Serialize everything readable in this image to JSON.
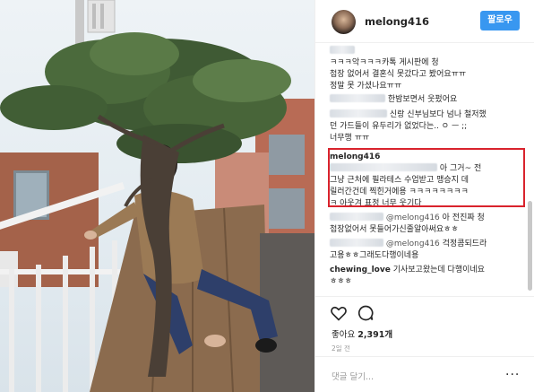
{
  "header": {
    "username": "melong416",
    "follow_label": "팔로우"
  },
  "comments": [
    {
      "text_lines": [
        "ㅋㅋㅋ악ㅋㅋㅋ카톡 게시판에 청",
        "첩장 없어서 결혼식 못갔다고 봤어요ㅠㅠ",
        "정말 못 가셨나요ㅠㅠ"
      ]
    },
    {
      "text": "한밤보면서 웃펐어요"
    },
    {
      "text_lines": [
        "신랑 신부님보다 넘나 철저했",
        "던 가드들이 유두리가 없었다는.. ㅇ ㅡ ;;",
        "너무행 ㅠㅠ"
      ]
    },
    {
      "user": "melong416",
      "text_lines": [
        "아 그거~ 전",
        "그냥 근처에 필라테스 수업받고 맹승지 데",
        "릴러간건데 찍힌거에용 ㅋㅋㅋㅋㅋㅋㅋㅋ",
        "ㅋ 아웃겨 표정 너무 웃기다"
      ]
    },
    {
      "mention": "@melong416",
      "text_lines": [
        "아 전진짜 청",
        "첩장없어서 못들어가신줄알아써요ㅎㅎ"
      ]
    },
    {
      "mention": "@melong416",
      "text_lines": [
        "걱정콤되드라",
        "고용ㅎㅎ그래도다행이네용"
      ]
    },
    {
      "user": "chewing_love",
      "text": "기사보고왔는데 다행이네요",
      "text2": "ㅎㅎㅎ"
    }
  ],
  "actions": {
    "like_icon": "heart-outline",
    "comment_icon": "speech-bubble",
    "likes_prefix": "좋아요",
    "likes_count": "2,391개",
    "timestamp": "2일 전",
    "comment_placeholder": "댓글 달기...",
    "more_label": "···"
  },
  "colors": {
    "follow_button": "#3897f0",
    "highlight_box": "#d9232d"
  }
}
